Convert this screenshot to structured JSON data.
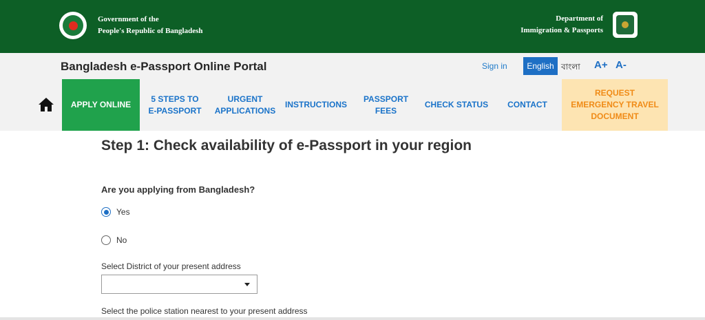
{
  "header": {
    "gov_line1": "Government of the",
    "gov_line2": "People's Republic of Bangladesh",
    "dept_line1": "Department of",
    "dept_line2": "Immigration & Passports",
    "emblem_icon": "bangladesh-emblem-icon",
    "dept_icon": "dip-logo-icon",
    "color": "#0d5f26"
  },
  "portal": {
    "title": "Bangladesh e-Passport Online Portal",
    "signin": "Sign in",
    "lang_english": "English",
    "lang_bangla": "বাংলা",
    "font_increase": "A+",
    "font_decrease": "A-"
  },
  "nav": {
    "home_icon": "home-icon",
    "apply_online": "APPLY ONLINE",
    "steps_line1": "5 STEPS TO",
    "steps_line2": "E-PASSPORT",
    "urgent_line1": "URGENT",
    "urgent_line2": "APPLICATIONS",
    "instructions": "INSTRUCTIONS",
    "fees_line1": "PASSPORT",
    "fees_line2": "FEES",
    "check_status": "CHECK STATUS",
    "contact": "CONTACT",
    "emergency_line1": "REQUEST",
    "emergency_line2": "EMERGENCY TRAVEL",
    "emergency_line3": "DOCUMENT",
    "active_color": "#20a24c",
    "emergency_bg": "#fde4b2",
    "emergency_color": "#f08b17",
    "link_color": "#1a73c9"
  },
  "main": {
    "step_title": "Step 1: Check availability of e-Passport in your region",
    "question": "Are you applying from Bangladesh?",
    "option_yes": "Yes",
    "option_no": "No",
    "selected": "Yes",
    "district_label": "Select District of your present address",
    "district_value": "",
    "police_label": "Select the police station nearest to your present address"
  }
}
